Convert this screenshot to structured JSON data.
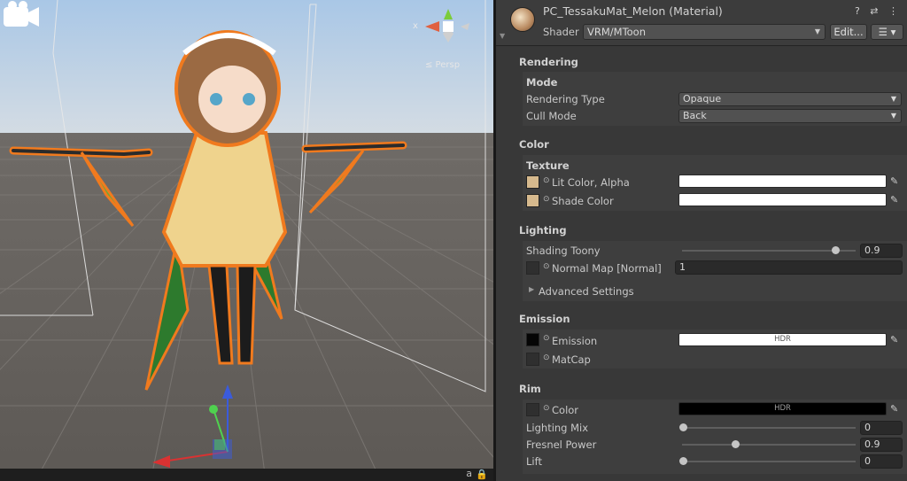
{
  "scene": {
    "perspective_label": "≤ Persp",
    "gizmo_x_label": "x",
    "bottom_glyph": "a",
    "bottom_lock_glyph": "🔒"
  },
  "inspector": {
    "title": "PC_TessakuMat_Melon (Material)",
    "header_icons": "? ⇄ ⋮",
    "shader_label": "Shader",
    "shader_value": "VRM/MToon",
    "edit_button": "Edit...",
    "list_button": "☰ ▾",
    "rendering": {
      "heading": "Rendering",
      "mode_heading": "Mode",
      "rendering_type_label": "Rendering Type",
      "rendering_type_value": "Opaque",
      "cull_mode_label": "Cull Mode",
      "cull_mode_value": "Back"
    },
    "color": {
      "heading": "Color",
      "texture_heading": "Texture",
      "lit_color_label": "Lit Color, Alpha",
      "shade_color_label": "Shade Color",
      "lit_color_hex": "#ffffff",
      "shade_color_hex": "#ffffff"
    },
    "lighting": {
      "heading": "Lighting",
      "shading_toony_label": "Shading Toony",
      "shading_toony_value": "0.9",
      "normal_map_label": "Normal Map [Normal]",
      "normal_map_value": "1",
      "advanced_label": "Advanced Settings"
    },
    "emission": {
      "heading": "Emission",
      "emission_label": "Emission",
      "emission_hdr": "HDR",
      "matcap_label": "MatCap"
    },
    "rim": {
      "heading": "Rim",
      "color_label": "Color",
      "color_hdr": "HDR",
      "lighting_mix_label": "Lighting Mix",
      "lighting_mix_value": "0",
      "fresnel_label": "Fresnel Power",
      "fresnel_value": "0.9",
      "lift_label": "Lift",
      "lift_value": "0"
    }
  }
}
